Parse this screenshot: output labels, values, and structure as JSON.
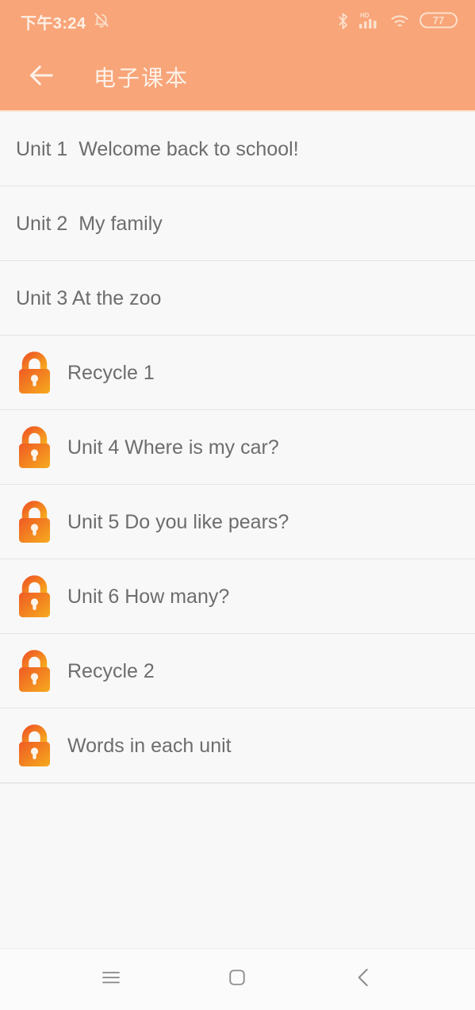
{
  "status_bar": {
    "time": "下午3:24",
    "icons_left": [
      "bell-muted-icon"
    ],
    "icons_right": [
      "bluetooth-icon",
      "hd-signal-icon",
      "wifi-icon",
      "battery-icon"
    ],
    "battery_level": "77"
  },
  "app_bar": {
    "back_icon": "arrow-left-icon",
    "title": "电子课本"
  },
  "colors": {
    "header_bg": "#f8a579",
    "header_text": "#fdf1e8",
    "list_bg": "#f8f8f8",
    "row_text": "#6d6d6d",
    "separator": "#e4e4e4",
    "lock_gradient_start": "#ef5f28",
    "lock_gradient_end": "#f5a623"
  },
  "list": {
    "items": [
      {
        "label": "Unit 1  Welcome back to school!",
        "locked": false
      },
      {
        "label": "Unit 2  My family",
        "locked": false
      },
      {
        "label": "Unit 3 At the zoo",
        "locked": false
      },
      {
        "label": "Recycle 1",
        "locked": true
      },
      {
        "label": "Unit 4 Where is my car?",
        "locked": true
      },
      {
        "label": "Unit 5 Do you like pears?",
        "locked": true
      },
      {
        "label": "Unit 6 How many?",
        "locked": true
      },
      {
        "label": "Recycle 2",
        "locked": true
      },
      {
        "label": "Words in each unit",
        "locked": true
      }
    ]
  },
  "nav_bar": {
    "buttons": [
      {
        "name": "menu-icon"
      },
      {
        "name": "home-icon"
      },
      {
        "name": "back-icon"
      }
    ]
  }
}
